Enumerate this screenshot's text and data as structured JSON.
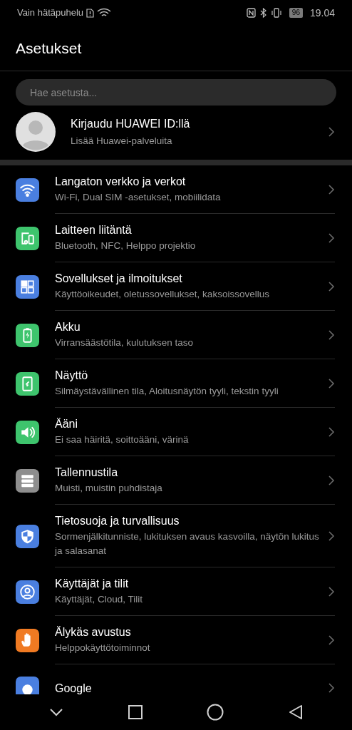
{
  "status_bar": {
    "carrier": "Vain hätäpuhelu",
    "battery": "96",
    "time": "19.04"
  },
  "header": {
    "title": "Asetukset"
  },
  "search": {
    "placeholder": "Hae asetusta..."
  },
  "account": {
    "title": "Kirjaudu HUAWEI ID:llä",
    "subtitle": "Lisää Huawei-palveluita"
  },
  "items": [
    {
      "title": "Langaton verkko ja verkot",
      "subtitle": "Wi-Fi, Dual SIM -asetukset, mobiilidata",
      "color": "#4a7fe0"
    },
    {
      "title": "Laitteen liitäntä",
      "subtitle": "Bluetooth, NFC, Helppo projektio",
      "color": "#3ec46d"
    },
    {
      "title": "Sovellukset ja ilmoitukset",
      "subtitle": "Käyttöoikeudet, oletussovellukset, kaksoissovellus",
      "color": "#4a7fe0"
    },
    {
      "title": "Akku",
      "subtitle": "Virransäästötila, kulutuksen taso",
      "color": "#3ec46d"
    },
    {
      "title": "Näyttö",
      "subtitle": "Silmäystävällinen tila, Aloitusnäytön tyyli, tekstin tyyli",
      "color": "#3ec46d"
    },
    {
      "title": "Ääni",
      "subtitle": "Ei saa häiritä, soittoääni, värinä",
      "color": "#3ec46d"
    },
    {
      "title": "Tallennustila",
      "subtitle": "Muisti, muistin puhdistaja",
      "color": "#8e8e8e"
    },
    {
      "title": "Tietosuoja ja turvallisuus",
      "subtitle": "Sormenjälkitunniste, lukituksen avaus kasvoilla, näytön lukitus ja salasanat",
      "color": "#4a7fe0"
    },
    {
      "title": "Käyttäjät ja tilit",
      "subtitle": "Käyttäjät, Cloud, Tilit",
      "color": "#4a7fe0"
    },
    {
      "title": "Älykäs avustus",
      "subtitle": "Helppokäyttötoiminnot",
      "color": "#f07a22"
    },
    {
      "title": "Google",
      "color": "#4a7fe0"
    }
  ]
}
